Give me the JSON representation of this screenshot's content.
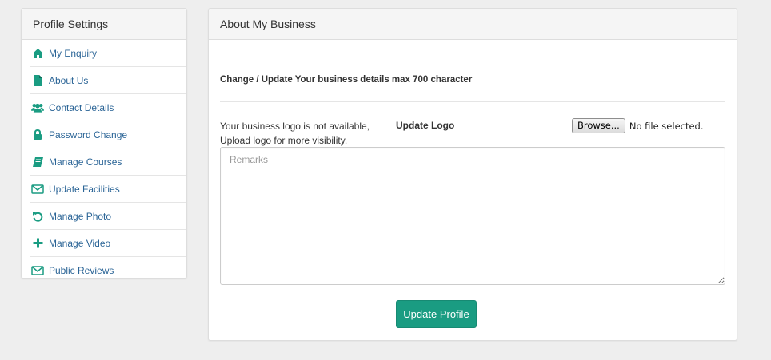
{
  "sidebar": {
    "title": "Profile Settings",
    "items": [
      {
        "label": "My Enquiry",
        "icon": "home-icon"
      },
      {
        "label": "About Us",
        "icon": "file-icon"
      },
      {
        "label": "Contact Details",
        "icon": "users-icon"
      },
      {
        "label": "Password Change",
        "icon": "lock-icon"
      },
      {
        "label": "Manage Courses",
        "icon": "book-icon"
      },
      {
        "label": "Update Facilities",
        "icon": "envelope-icon"
      },
      {
        "label": "Manage Photo",
        "icon": "undo-icon"
      },
      {
        "label": "Manage Video",
        "icon": "plus-icon"
      },
      {
        "label": "Public Reviews",
        "icon": "envelope-icon"
      }
    ]
  },
  "main": {
    "title": "About My Business",
    "subtitle": "Change / Update Your business details max 700 character",
    "logo_note_line1": "Your business logo is not available,",
    "logo_note_line2": "Upload logo for more visibility.",
    "logo_label": "Update Logo",
    "browse_label": "Browse...",
    "file_status": "No file selected.",
    "remarks_placeholder": "Remarks",
    "remarks_value": "",
    "submit_label": "Update Profile"
  },
  "colors": {
    "accent": "#1a9c82",
    "link": "#2a6496",
    "background": "#eeeeee"
  }
}
